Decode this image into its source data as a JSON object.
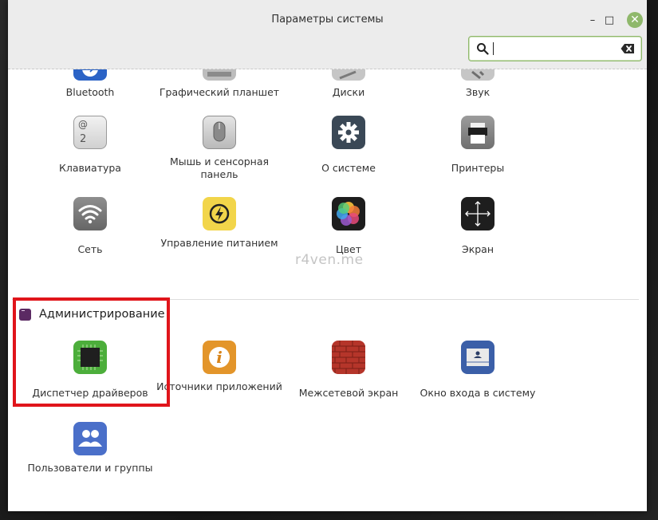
{
  "window": {
    "title": "Параметры системы",
    "minimize_glyph": "–",
    "maximize_glyph": "□",
    "close_glyph": "✕"
  },
  "search": {
    "value": "",
    "placeholder": ""
  },
  "top_row": [
    {
      "label": "Bluetooth",
      "icon": "bluetooth-icon"
    },
    {
      "label": "Графический планшет",
      "icon": "tablet-icon"
    },
    {
      "label": "Диски",
      "icon": "disks-icon"
    },
    {
      "label": "Звук",
      "icon": "sound-icon"
    }
  ],
  "hardware": [
    {
      "label": "Клавиатура",
      "icon": "keyboard-icon",
      "glyph_top": "@",
      "glyph_bottom": "2"
    },
    {
      "label": "Мышь и сенсорная панель",
      "icon": "mouse-icon"
    },
    {
      "label": "О системе",
      "icon": "gear-icon"
    },
    {
      "label": "Принтеры",
      "icon": "printer-icon"
    },
    {
      "label": "Сеть",
      "icon": "wifi-icon"
    },
    {
      "label": "Управление питанием",
      "icon": "power-icon"
    },
    {
      "label": "Цвет",
      "icon": "color-icon"
    },
    {
      "label": "Экран",
      "icon": "display-icon"
    }
  ],
  "watermark": "r4ven.me",
  "admin": {
    "title": "Администрирование",
    "items": [
      {
        "label": "Диспетчер драйверов",
        "icon": "driver-manager-icon"
      },
      {
        "label": "Источники приложений",
        "icon": "info-icon",
        "glyph": "i"
      },
      {
        "label": "Межсетевой экран",
        "icon": "firewall-icon"
      },
      {
        "label": "Окно входа в систему",
        "icon": "login-window-icon"
      },
      {
        "label": "Пользователи и группы",
        "icon": "users-icon"
      }
    ]
  },
  "colors": {
    "accent": "#8fb86b",
    "highlight": "#e0151b",
    "section_icon": "#5b2a63"
  }
}
